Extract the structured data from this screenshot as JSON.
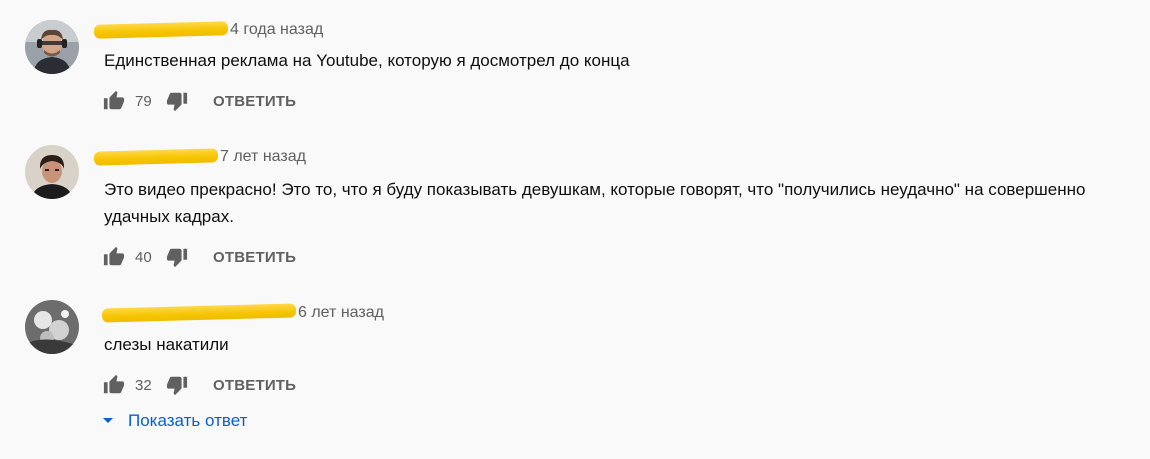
{
  "comments": [
    {
      "time": "4 года назад",
      "text": "Единственная реклама на Youtube, которую я досмотрел до конца",
      "likes": "79",
      "reply_label": "ОТВЕТИТЬ"
    },
    {
      "time": "7 лет назад",
      "text": "Это видео прекрасно! Это то, что я буду показывать девушкам, которые говорят, что \"получились неудачно\" на совершенно удачных кадрах.",
      "likes": "40",
      "reply_label": "ОТВЕТИТЬ"
    },
    {
      "time": "6 лет назад",
      "text": "слезы накатили",
      "likes": "32",
      "reply_label": "ОТВЕТИТЬ"
    }
  ],
  "show_replies_label": "Показать ответ",
  "colors": {
    "background": "#f9f9f9",
    "text": "#0f0f0f",
    "muted": "#606060",
    "link": "#065fd4",
    "redaction": "#f6c400"
  },
  "icons": [
    "thumb-up-icon",
    "thumb-down-icon",
    "caret-down-icon"
  ]
}
